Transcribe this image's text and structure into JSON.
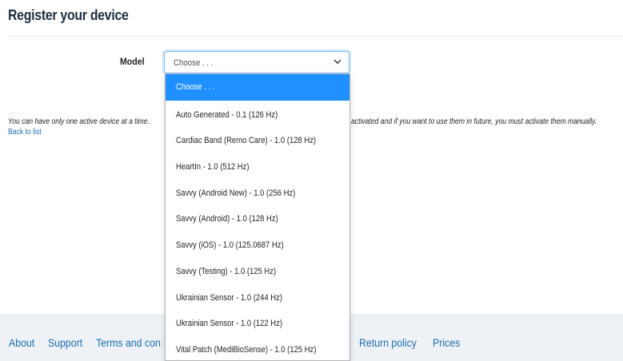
{
  "page": {
    "title": "Register your device"
  },
  "form": {
    "model_label": "Model",
    "select_value": "Choose . . ."
  },
  "notice": {
    "text_left": "You can have only one active device at a time.",
    "text_right": "activated and if you want to use them in future, you must activate them manually."
  },
  "back_link": "Back to list",
  "dropdown": {
    "options": [
      "Choose . . .",
      "Auto Generated - 0.1 (126 Hz)",
      "Cardiac Band (Remo Care) - 1.0 (128 Hz)",
      "HeartIn - 1.0 (512 Hz)",
      "Savvy (Android New) - 1.0 (256 Hz)",
      "Savvy (Android) - 1.0 (128 Hz)",
      "Savvy (iOS) - 1.0 (125.0687 Hz)",
      "Savvy (Testing) - 1.0 (125 Hz)",
      "Ukrainian Sensor - 1.0 (244 Hz)",
      "Ukrainian Sensor - 1.0 (122 Hz)",
      "Vital Patch (MediBioSense) - 1.0 (125 Hz)"
    ],
    "selected_index": 0,
    "selected_color": "#1e90ff"
  },
  "footer": {
    "links": [
      "About",
      "Support",
      "Terms and con",
      "Return policy",
      "Prices"
    ]
  },
  "colors": {
    "link": "#1a6fb0",
    "footer_bg": "#eef2f6"
  }
}
